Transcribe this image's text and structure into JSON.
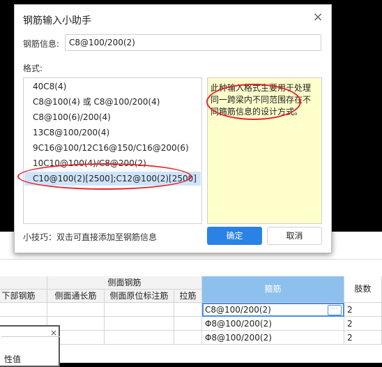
{
  "dialog": {
    "title": "钢筋输入小助手",
    "close_glyph": "×",
    "info_label": "钢筋信息:",
    "info_value": "C8@100/200(2)",
    "format_label": "格式:",
    "formats": [
      "40C8(4)",
      "C8@100(4) 或 C8@100/200(4)",
      "C8@100(6)/200(4)",
      "13C8@100/200(4)",
      "9C16@100/12C16@150/C16@200(6)",
      "10C10@100(4)/C8@200(2)",
      "C10@100(2)[2500];C12@100(2)[2500]"
    ],
    "selected_index": 6,
    "note": "此种输入格式主要用于处理同一跨梁内不同范围存在不同箍筋信息的设计方式。",
    "tip": "小技巧：双击可直接添加至钢筋信息",
    "ok_label": "确定",
    "cancel_label": "取消"
  },
  "sheet": {
    "group_header": "侧面钢筋",
    "col_bottom": "下部钢筋",
    "col_side_through": "侧面通长筋",
    "col_side_orig": "侧面原位标注筋",
    "col_tie": "拉筋",
    "col_stirrup": "箍筋",
    "col_legs": "肢数",
    "rows": [
      {
        "stirrup": "C8@100/200(2)",
        "legs": "2"
      },
      {
        "stirrup": "Φ8@100/200(2)",
        "legs": "2"
      },
      {
        "stirrup": "Φ8@100/200(2)",
        "legs": "2"
      }
    ],
    "more_glyph": "⋯"
  },
  "mini_panel": {
    "close_glyph": "×",
    "label": "性值"
  },
  "colors": {
    "accent": "#2a82e4",
    "note_bg": "#ffffcc",
    "annotation": "#e8232b",
    "selected_row": "#cfe4fa",
    "stirrup_header": "#8ec0ee"
  }
}
